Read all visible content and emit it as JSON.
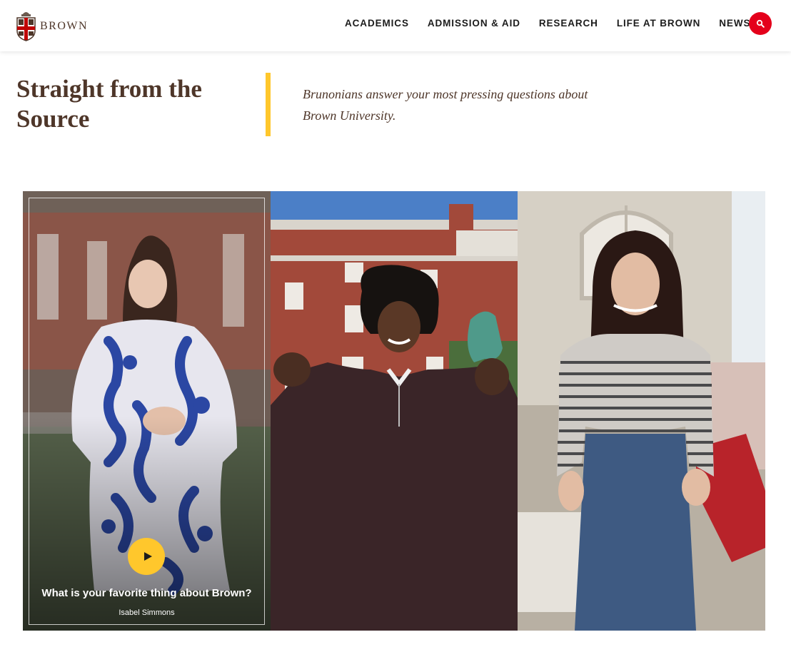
{
  "header": {
    "logo_text": "BROWN",
    "nav": [
      {
        "label": "ACADEMICS"
      },
      {
        "label": "ADMISSION & AID"
      },
      {
        "label": "RESEARCH"
      },
      {
        "label": "LIFE AT BROWN"
      },
      {
        "label": "NEWS"
      }
    ],
    "search_icon": "search-icon"
  },
  "intro": {
    "title": "Straight from the Source",
    "description": "Brunonians answer your most pressing questions about Brown University."
  },
  "videos": [
    {
      "question": "What is your favorite thing about Brown?",
      "name": "Isabel Simmons",
      "play_icon": "play-icon"
    },
    {},
    {}
  ],
  "colors": {
    "brown": "#4e3629",
    "red": "#e4001b",
    "gold": "#ffc72c",
    "white": "#ffffff"
  }
}
